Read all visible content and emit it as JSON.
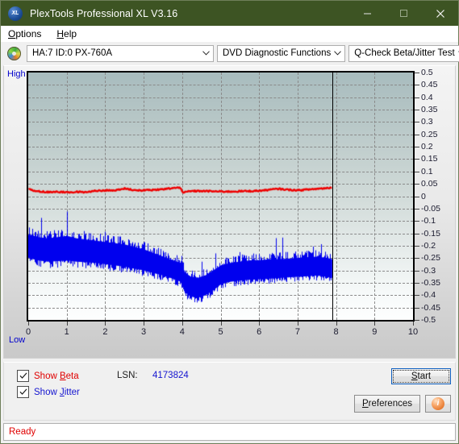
{
  "window": {
    "title": "PlexTools Professional XL V3.16",
    "app_icon": "xl-logo-icon",
    "minimize_label": "—",
    "maximize_label": "□",
    "close_label": "✕"
  },
  "menubar": {
    "items": [
      {
        "label": "Options",
        "accel": "O"
      },
      {
        "label": "Help",
        "accel": "H"
      }
    ]
  },
  "toolbar": {
    "drive_icon": "disc-icon",
    "drive_select": "HA:7 ID:0  PX-760A",
    "function_select": "DVD Diagnostic Functions",
    "test_select": "Q-Check Beta/Jitter Test",
    "arrow": "⌄"
  },
  "chart": {
    "label_high": "High",
    "label_low": "Low"
  },
  "chart_data": {
    "type": "line",
    "title": "Q-Check Beta/Jitter Test",
    "xlabel": "",
    "ylabel": "",
    "xlim": [
      0,
      10
    ],
    "ylim": [
      -0.5,
      0.5
    ],
    "xticks": [
      0,
      1,
      2,
      3,
      4,
      5,
      6,
      7,
      8,
      9,
      10
    ],
    "yticks": [
      0.5,
      0.45,
      0.4,
      0.35,
      0.3,
      0.25,
      0.2,
      0.15,
      0.1,
      0.05,
      0,
      -0.05,
      -0.1,
      -0.15,
      -0.2,
      -0.25,
      -0.3,
      -0.35,
      -0.4,
      -0.45,
      -0.5
    ],
    "grid": true,
    "grid_style": "dashed",
    "legend": [
      "Show Beta",
      "Show Jitter"
    ],
    "annotations": [
      {
        "type": "vline",
        "x": 7.9,
        "label": "scan-end-marker",
        "color": "#000000"
      },
      {
        "type": "axis-label",
        "text": "High",
        "position": "top-left",
        "color": "#0000cc"
      },
      {
        "type": "axis-label",
        "text": "Low",
        "position": "bottom-left",
        "color": "#0000cc"
      }
    ],
    "data_end_x": 7.9,
    "series": [
      {
        "name": "Beta",
        "color": "#ee0000",
        "type": "line",
        "x": [
          0.0,
          0.25,
          0.5,
          0.75,
          1.0,
          1.25,
          1.5,
          1.75,
          2.0,
          2.25,
          2.5,
          2.75,
          3.0,
          3.25,
          3.5,
          3.75,
          3.95,
          4.02,
          4.15,
          4.3,
          4.5,
          4.75,
          5.0,
          5.25,
          5.5,
          5.75,
          6.0,
          6.25,
          6.5,
          6.75,
          7.0,
          7.25,
          7.5,
          7.75,
          7.9
        ],
        "values": [
          0.028,
          0.02,
          0.017,
          0.018,
          0.016,
          0.018,
          0.016,
          0.022,
          0.024,
          0.023,
          0.031,
          0.024,
          0.024,
          0.025,
          0.028,
          0.033,
          0.034,
          0.014,
          0.019,
          0.021,
          0.021,
          0.02,
          0.019,
          0.019,
          0.02,
          0.021,
          0.022,
          0.026,
          0.03,
          0.026,
          0.024,
          0.027,
          0.03,
          0.033,
          0.036
        ]
      },
      {
        "name": "Jitter (upper envelope)",
        "color": "#0000ee",
        "type": "band-upper",
        "x": [
          0.0,
          0.25,
          0.5,
          0.75,
          1.0,
          1.25,
          1.5,
          1.75,
          2.0,
          2.25,
          2.5,
          2.75,
          3.0,
          3.25,
          3.5,
          3.75,
          3.95,
          4.05,
          4.2,
          4.4,
          4.6,
          4.8,
          5.0,
          5.25,
          5.5,
          5.75,
          6.0,
          6.25,
          6.5,
          6.75,
          7.0,
          7.25,
          7.5,
          7.75,
          7.9
        ],
        "values": [
          -0.15,
          -0.16,
          -0.165,
          -0.16,
          -0.155,
          -0.165,
          -0.17,
          -0.175,
          -0.18,
          -0.185,
          -0.19,
          -0.2,
          -0.21,
          -0.225,
          -0.24,
          -0.255,
          -0.265,
          -0.3,
          -0.32,
          -0.325,
          -0.315,
          -0.295,
          -0.275,
          -0.265,
          -0.26,
          -0.255,
          -0.255,
          -0.25,
          -0.25,
          -0.248,
          -0.245,
          -0.242,
          -0.24,
          -0.245,
          -0.25
        ]
      },
      {
        "name": "Jitter (lower envelope)",
        "color": "#0000ee",
        "type": "band-lower",
        "x": [
          0.0,
          0.25,
          0.5,
          0.75,
          1.0,
          1.25,
          1.5,
          1.75,
          2.0,
          2.25,
          2.5,
          2.75,
          3.0,
          3.25,
          3.5,
          3.75,
          3.95,
          4.05,
          4.2,
          4.4,
          4.6,
          4.8,
          5.0,
          5.25,
          5.5,
          5.75,
          6.0,
          6.25,
          6.5,
          6.75,
          7.0,
          7.25,
          7.5,
          7.75,
          7.9
        ],
        "values": [
          -0.255,
          -0.265,
          -0.27,
          -0.268,
          -0.265,
          -0.27,
          -0.272,
          -0.275,
          -0.28,
          -0.285,
          -0.29,
          -0.298,
          -0.305,
          -0.315,
          -0.325,
          -0.338,
          -0.35,
          -0.39,
          -0.41,
          -0.415,
          -0.405,
          -0.385,
          -0.36,
          -0.35,
          -0.345,
          -0.342,
          -0.34,
          -0.338,
          -0.335,
          -0.332,
          -0.33,
          -0.328,
          -0.325,
          -0.33,
          -0.335
        ]
      }
    ]
  },
  "controls": {
    "show_beta": {
      "label": "Show Beta",
      "accel": "B",
      "checked": true,
      "color": "#e00000"
    },
    "show_jitter": {
      "label": "Show Jitter",
      "accel": "J",
      "checked": true,
      "color": "#1414d0"
    },
    "lsn_label": "LSN:",
    "lsn_value": "4173824",
    "start_label": "Start",
    "start_accel": "S",
    "preferences_label": "Preferences",
    "preferences_accel": "P",
    "info_icon": "info-icon",
    "info_glyph": "i"
  },
  "statusbar": {
    "text": "Ready"
  }
}
